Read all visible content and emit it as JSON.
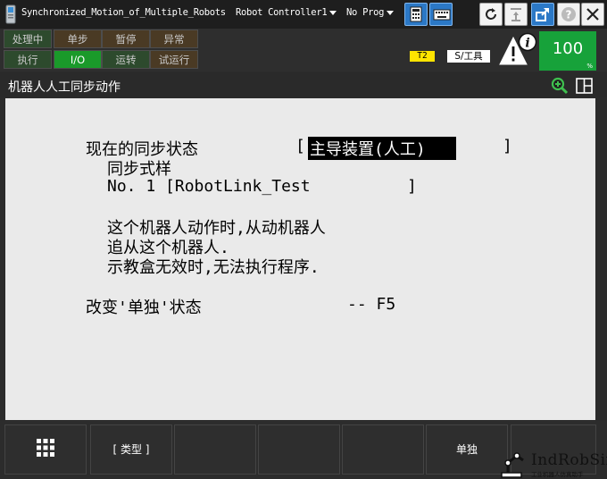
{
  "titlebar": {
    "title": "Synchronized_Motion_of_Multiple_Robots",
    "controller": "Robot Controller1",
    "program": "No Prog"
  },
  "status_leds": [
    {
      "label": "处理中",
      "state": "off"
    },
    {
      "label": "单步",
      "state": "off"
    },
    {
      "label": "暂停",
      "state": "off"
    },
    {
      "label": "异常",
      "state": "off"
    },
    {
      "label": "执行",
      "state": "off"
    },
    {
      "label": "I/O",
      "state": "on"
    },
    {
      "label": "运转",
      "state": "off"
    },
    {
      "label": "试运行",
      "state": "off"
    }
  ],
  "mode": {
    "t2": "T2",
    "tool": "S/工具"
  },
  "override": {
    "value": "100",
    "unit": "%"
  },
  "screen": {
    "title": "机器人人工同步动作"
  },
  "content": {
    "sync_state_label": "现在的同步状态",
    "bracket_open": "[",
    "sync_state_value": "主导装置(人工)   ",
    "bracket_close": "]",
    "sync_style_label": "同步式样",
    "sync_no": "No. 1 [RobotLink_Test          ]",
    "desc_1": "这个机器人动作时,从动机器人",
    "desc_2": "追从这个机器人.",
    "desc_3": "示教盒无效时,无法执行程序.",
    "change_label": "改变'单独'状态",
    "change_key": "-- F5"
  },
  "fkeys": [
    "",
    "[ 类型 ]",
    "",
    "",
    "",
    "单独",
    ""
  ],
  "watermark": {
    "text": "IndRobSim",
    "sub": "工业机器人仿真助手"
  },
  "colors": {
    "override_bg": "#17a23a",
    "io_led": "#1a9a2a",
    "t2_badge": "#ffe400",
    "content_bg": "#eaeaea"
  }
}
